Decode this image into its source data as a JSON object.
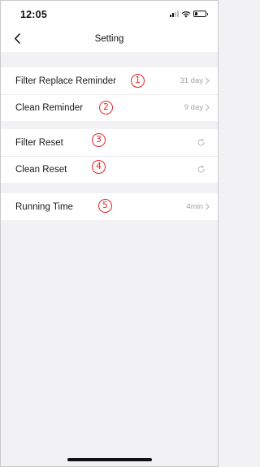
{
  "status_bar": {
    "time": "12:05"
  },
  "header": {
    "title": "Setting"
  },
  "groups": [
    {
      "items": [
        {
          "label": "Filter Replace Reminder",
          "marker": "1",
          "value": "31 day"
        },
        {
          "label": "Clean Reminder",
          "marker": "2",
          "value": "9 day"
        }
      ]
    },
    {
      "items": [
        {
          "label": "Filter Reset",
          "marker": "3"
        },
        {
          "label": "Clean Reset",
          "marker": "4"
        }
      ]
    },
    {
      "items": [
        {
          "label": "Running Time",
          "marker": "5",
          "value": "4min"
        }
      ]
    }
  ],
  "icons": {
    "back": "chevron-left-icon",
    "chevron": "chevron-right-icon",
    "reset": "refresh-icon",
    "signal": "cellular-signal-icon",
    "wifi": "wifi-icon",
    "battery": "battery-icon"
  },
  "colors": {
    "marker": "#e3262a",
    "background": "#f2f2f4",
    "value_text": "#a3a3a3"
  }
}
